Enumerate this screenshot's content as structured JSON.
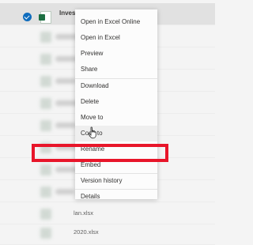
{
  "colors": {
    "accent": "#0f6cbd",
    "excel": "#1d6f42",
    "highlight": "#e8162a"
  },
  "file_list": {
    "selected_file_name": "Investment",
    "visible_names": [
      "lan.xlsx",
      "2020.xlsx"
    ]
  },
  "context_menu": {
    "items": [
      "Open in Excel Online",
      "Open in Excel",
      "Preview",
      "Share",
      "Download",
      "Delete",
      "Move to",
      "Copy to",
      "Rename",
      "Embed",
      "Version history",
      "Details"
    ],
    "hovered_item": "Copy to",
    "highlighted_item": "Version history"
  },
  "icons": {
    "check": "checkmark-circle-icon",
    "file": "excel-file-icon",
    "cursor": "hand-pointer-icon"
  }
}
